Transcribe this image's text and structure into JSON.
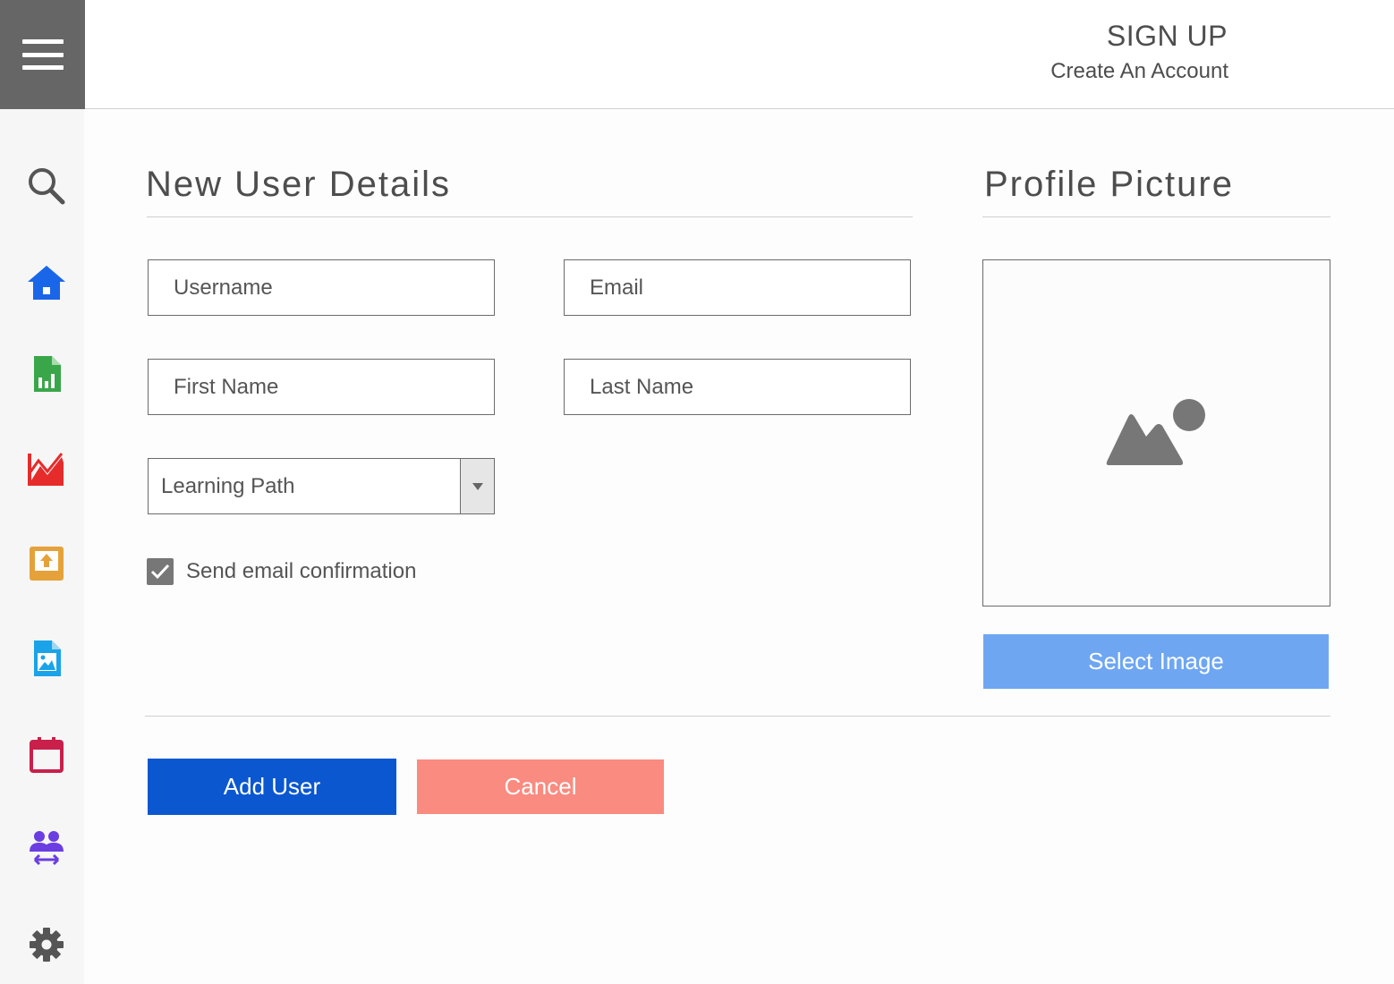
{
  "header": {
    "title": "SIGN UP",
    "subtitle": "Create An Account"
  },
  "sidebar": {
    "items": [
      {
        "icon": "search-icon",
        "color": "#555555"
      },
      {
        "icon": "home-icon",
        "color": "#1a66e8"
      },
      {
        "icon": "spreadsheet-icon",
        "color": "#3aa64a"
      },
      {
        "icon": "line-chart-icon",
        "color": "#e62b2b"
      },
      {
        "icon": "upload-tray-icon",
        "color": "#e5a23a"
      },
      {
        "icon": "image-file-icon",
        "color": "#1aa3e8"
      },
      {
        "icon": "calendar-icon",
        "color": "#c8204a"
      },
      {
        "icon": "user-swap-icon",
        "color": "#6a3ee0"
      },
      {
        "icon": "gear-icon",
        "color": "#555555"
      }
    ]
  },
  "form": {
    "title": "New User Details",
    "username_placeholder": "Username",
    "email_placeholder": "Email",
    "first_name_placeholder": "First Name",
    "last_name_placeholder": "Last Name",
    "learning_path": "Learning Path",
    "send_email_label": "Send email confirmation",
    "send_email_checked": true
  },
  "profile": {
    "title": "Profile Picture",
    "select_image_label": "Select Image"
  },
  "actions": {
    "add_user_label": "Add User",
    "cancel_label": "Cancel"
  },
  "colors": {
    "accent": "#0b57d0",
    "select_image": "#6ea6f2",
    "cancel": "#f98b80"
  }
}
